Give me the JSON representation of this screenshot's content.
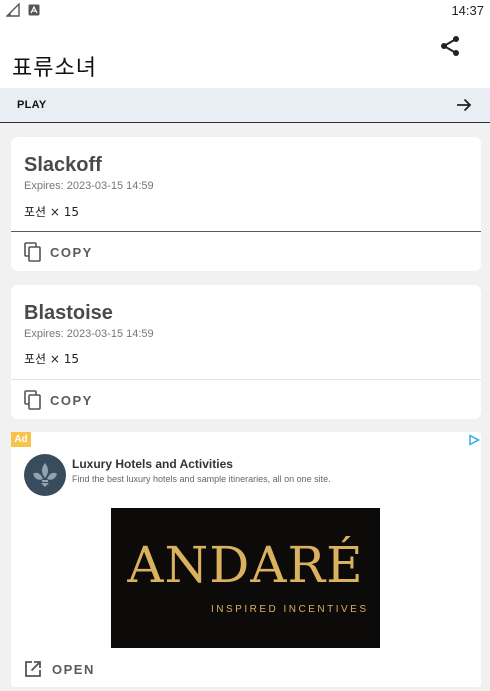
{
  "status_bar": {
    "time": "14:37",
    "icons": [
      "signal-icon",
      "notification-a-icon"
    ]
  },
  "app_bar": {
    "title": "표류소녀",
    "share_icon": "share-icon"
  },
  "play_bar": {
    "label": "PLAY",
    "arrow_icon": "arrow-right-icon"
  },
  "coupons": [
    {
      "title": "Slackoff",
      "expires": "Expires: 2023-03-15 14:59",
      "reward": "포션 × 15",
      "copy_label": "COPY"
    },
    {
      "title": "Blastoise",
      "expires": "Expires: 2023-03-15 14:59",
      "reward": "포션 × 15",
      "copy_label": "COPY"
    }
  ],
  "ad": {
    "badge": "Ad",
    "headline": "Luxury Hotels and Activities",
    "body": "Find the best luxury hotels and sample itineraries, all on one site.",
    "brand": "ANDARÉ",
    "tagline": "INSPIRED INCENTIVES",
    "open_label": "OPEN"
  },
  "colors": {
    "background": "#f1f1f1",
    "play_bar": "#e8eef4",
    "ad_badge": "#f7c34a",
    "ad_gold": "#d9b15f"
  }
}
